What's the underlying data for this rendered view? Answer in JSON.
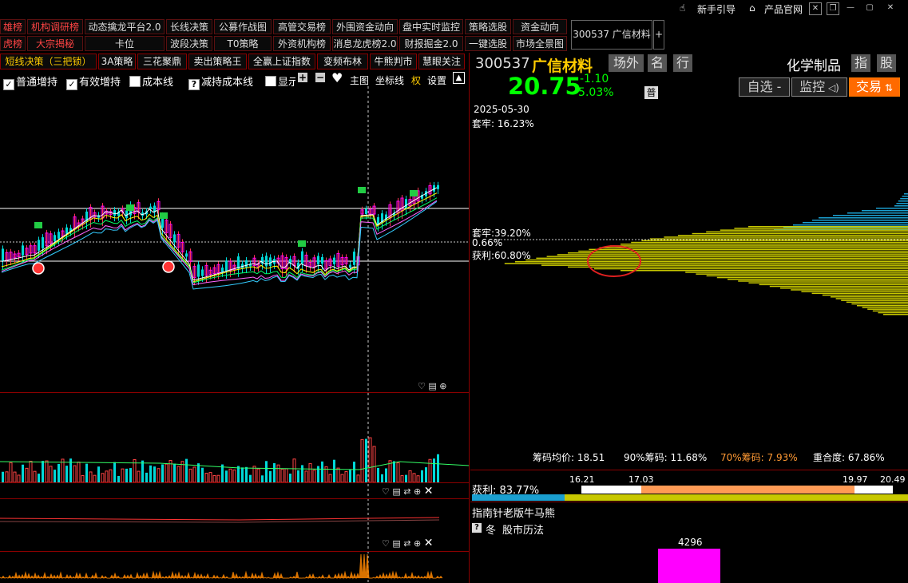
{
  "topbar": {
    "guide": "新手引导",
    "official_site": "产品官网"
  },
  "nav": {
    "row1": [
      "雄榜",
      "机构调研榜",
      "动态擒龙平台2.0",
      "长线决策",
      "公募作战图",
      "高管交易榜",
      "外围资金动向",
      "盘中实时监控",
      "策略选股",
      "资金动向"
    ],
    "row2": [
      "虎榜",
      "大宗揭秘",
      "卡位",
      "波段决策",
      "T0策略",
      "外资机构榜",
      "消息龙虎榜2.0",
      "财报掘金2.0",
      "一键选股",
      "市场全景图"
    ],
    "stock_tab": "300537 广信材料",
    "add_tab": "+"
  },
  "strategies": [
    "短线决策（三把锁）",
    "3A策略",
    "三花聚鼎",
    "卖出策略王",
    "全赢上证指数",
    "变频布林",
    "牛熊判市",
    "慧眼关注"
  ],
  "indicators": {
    "items": [
      {
        "label": "普通增持",
        "checked": true
      },
      {
        "label": "有效增持",
        "checked": true
      },
      {
        "label": "成本线",
        "checked": false
      },
      {
        "label": "减持成本线",
        "checked": false
      },
      {
        "label": "显示",
        "checked": false
      }
    ],
    "tools": [
      "主图",
      "坐标线",
      "权",
      "设置"
    ]
  },
  "stock": {
    "code": "300537",
    "name": "广信材料",
    "tags": [
      "场外",
      "名",
      "行"
    ],
    "price": "20.75",
    "change": "-1.10",
    "change_pct": "-5.03%",
    "pu_badge": "普",
    "sector": "化学制品",
    "sector_tags": [
      "指",
      "股"
    ],
    "buttons": {
      "watch": "自选 -",
      "monitor": "监控",
      "trade": "交易"
    }
  },
  "chip": {
    "date": "2025-05-30",
    "trapped_top": "套牢: 16.23%",
    "trapped_mid": "套牢:39.20%",
    "middle_pct": "0.66%",
    "profit_mid": "获利:60.80%",
    "stats": [
      {
        "label": "筹码均价:",
        "value": "18.51"
      },
      {
        "label": "90%筹码:",
        "value": "11.68%"
      },
      {
        "label": "70%筹码:",
        "value": "7.93%"
      },
      {
        "label": "重合度:",
        "value": "67.86%"
      }
    ],
    "profit_label": "获利: 83.77%",
    "range_ticks": [
      "16.21",
      "17.03",
      "19.97",
      "20.49"
    ],
    "bar_fractions": {
      "cyan": 0.21,
      "white": 0.36,
      "orange": 0.5,
      "yellow": 0.0
    }
  },
  "bottom": {
    "title": "指南针老版牛马熊",
    "season_icon": "?",
    "season": "冬",
    "calendar": "股市历法",
    "bar_value": "4296"
  },
  "colors": {
    "up": "#ff3333",
    "down": "#00e5e5",
    "price_green": "#00ff00",
    "chip_yellow": "#c8c800",
    "chip_blue": "#1a9fd0",
    "magenta": "#ff00ff"
  }
}
